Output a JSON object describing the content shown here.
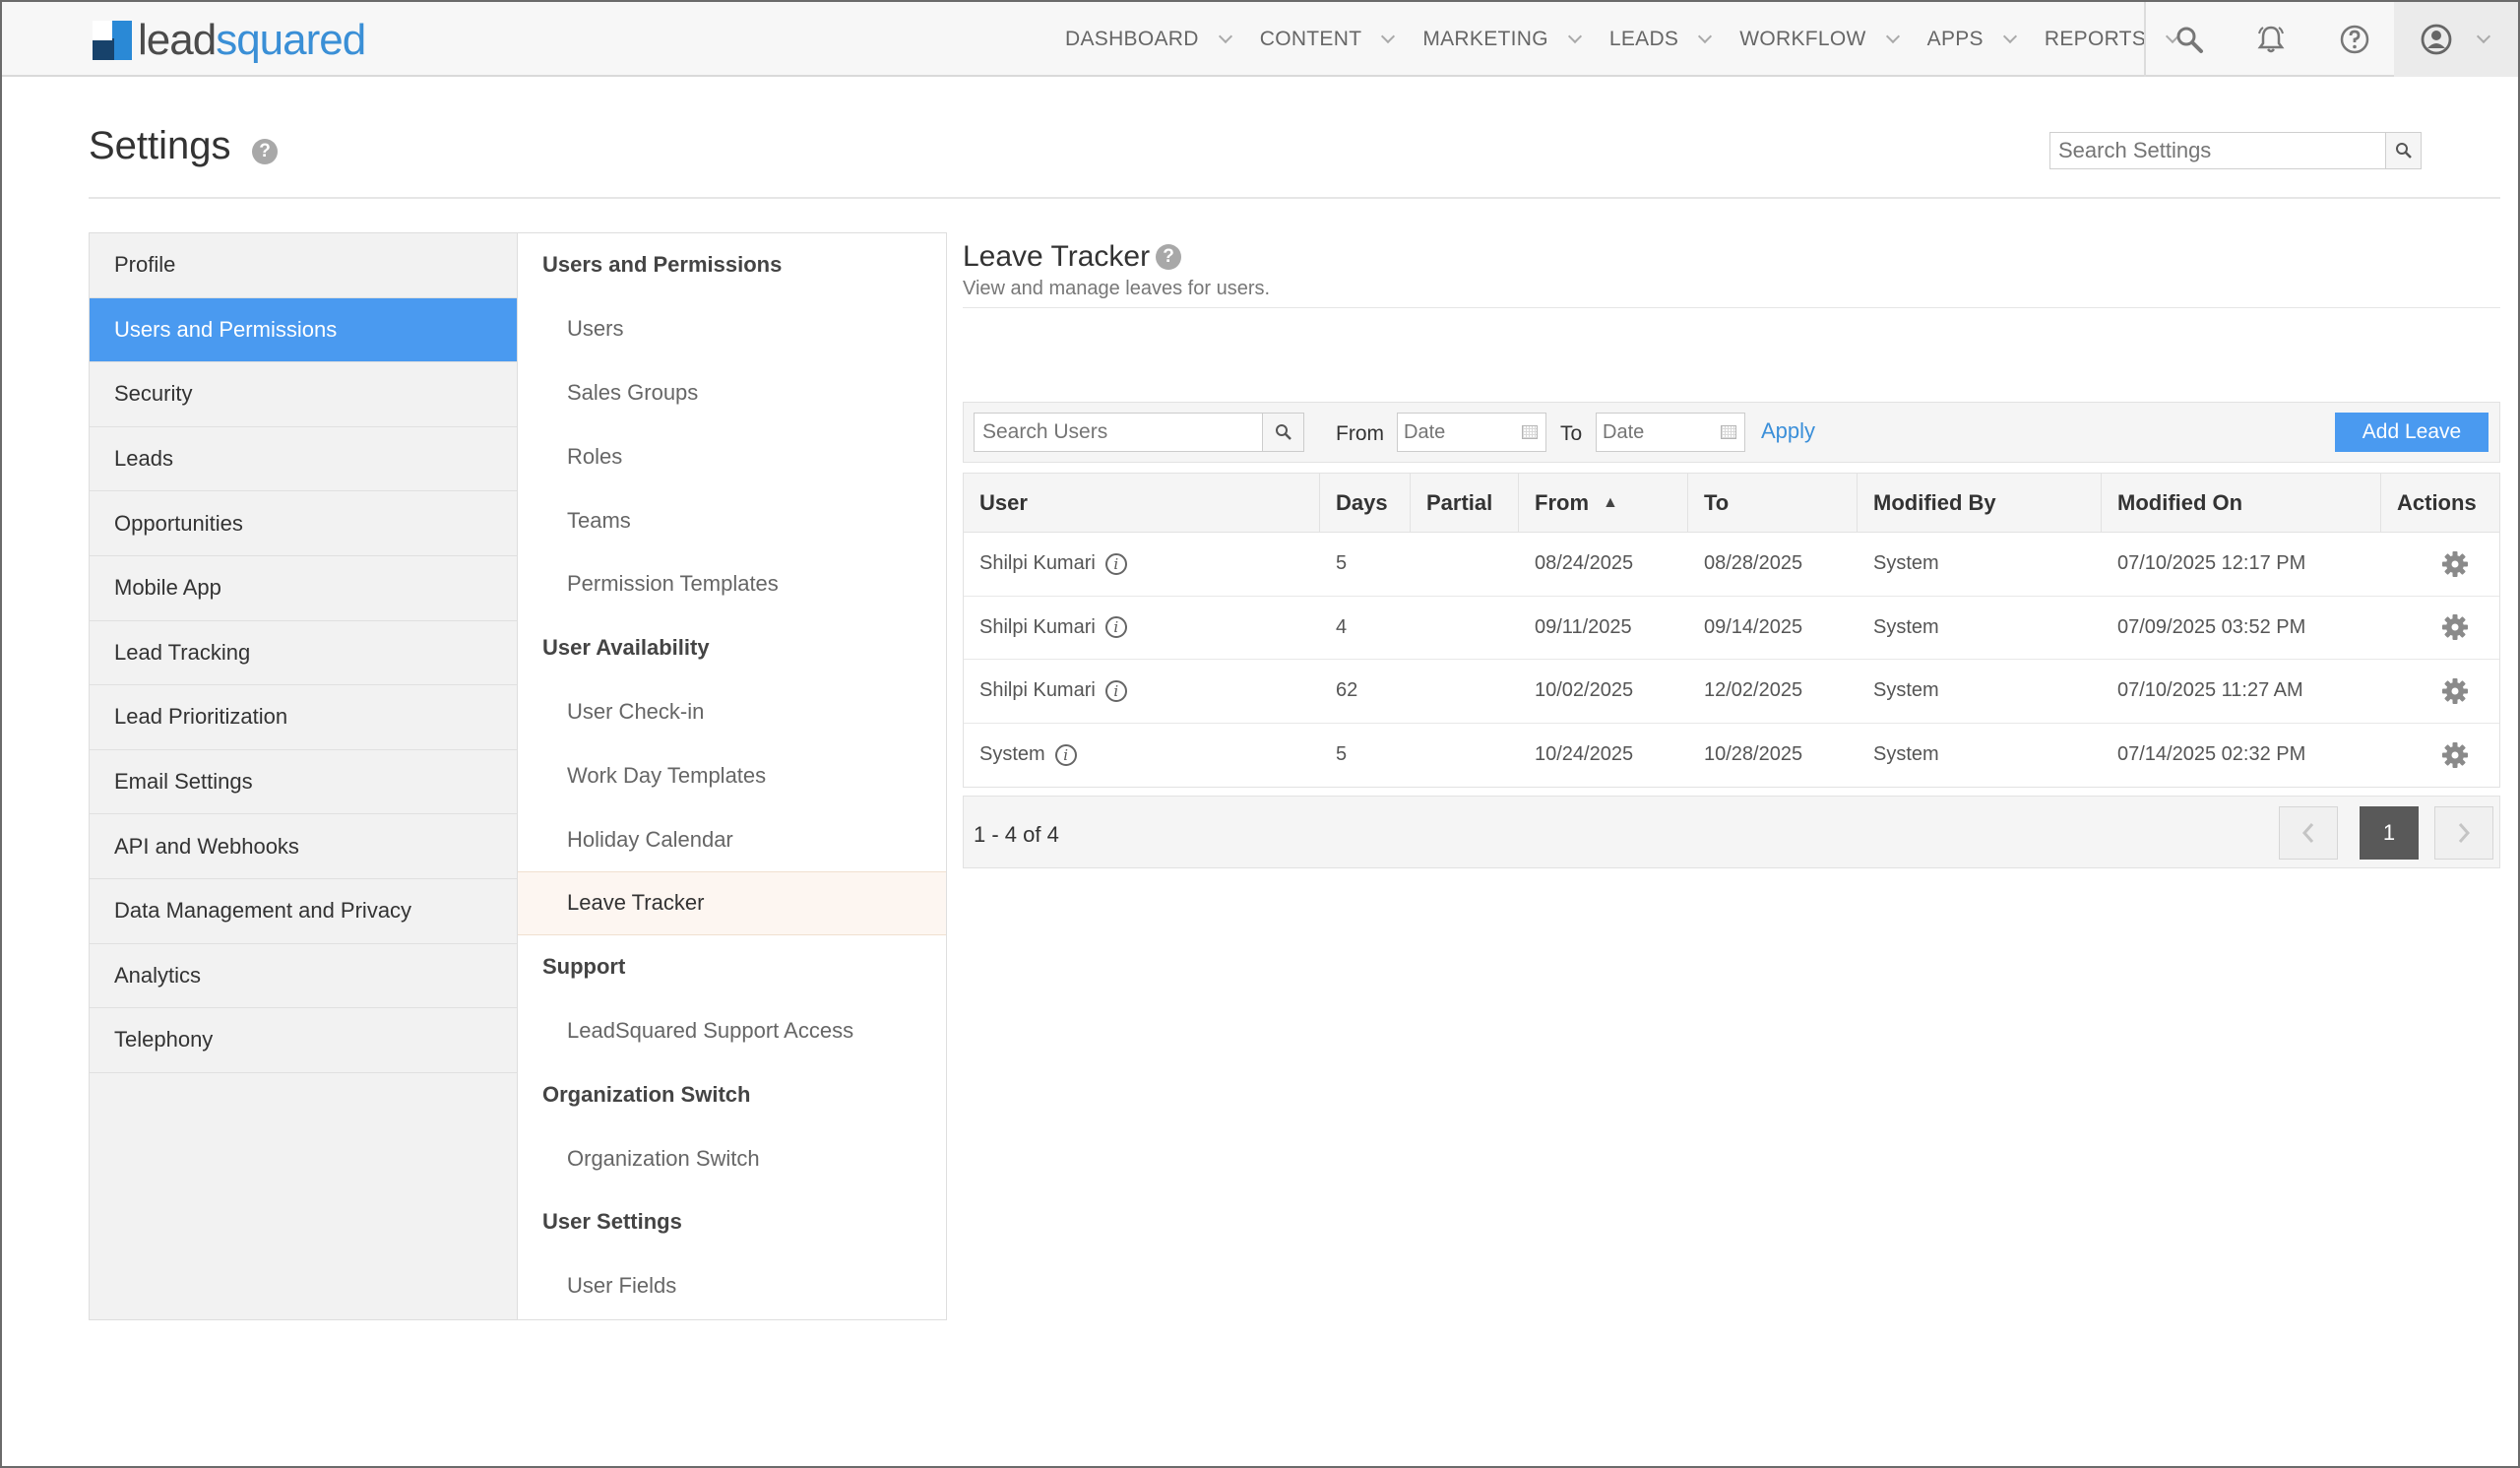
{
  "header": {
    "logo_part1": "lead",
    "logo_part2": "squared",
    "nav": [
      {
        "label": "DASHBOARD"
      },
      {
        "label": "CONTENT"
      },
      {
        "label": "MARKETING"
      },
      {
        "label": "LEADS"
      },
      {
        "label": "WORKFLOW"
      },
      {
        "label": "APPS"
      },
      {
        "label": "REPORTS"
      }
    ]
  },
  "page": {
    "title": "Settings",
    "help_glyph": "?",
    "search_placeholder": "Search Settings"
  },
  "left_menu": [
    {
      "label": "Profile",
      "active": false
    },
    {
      "label": "Users and Permissions",
      "active": true
    },
    {
      "label": "Security",
      "active": false
    },
    {
      "label": "Leads",
      "active": false
    },
    {
      "label": "Opportunities",
      "active": false
    },
    {
      "label": "Mobile App",
      "active": false
    },
    {
      "label": "Lead Tracking",
      "active": false
    },
    {
      "label": "Lead Prioritization",
      "active": false
    },
    {
      "label": "Email Settings",
      "active": false
    },
    {
      "label": "API and Webhooks",
      "active": false
    },
    {
      "label": "Data Management and Privacy",
      "active": false
    },
    {
      "label": "Analytics",
      "active": false
    },
    {
      "label": "Telephony",
      "active": false
    }
  ],
  "sub_menu": [
    {
      "type": "head",
      "label": "Users and Permissions"
    },
    {
      "type": "item",
      "label": "Users"
    },
    {
      "type": "item",
      "label": "Sales Groups"
    },
    {
      "type": "item",
      "label": "Roles"
    },
    {
      "type": "item",
      "label": "Teams"
    },
    {
      "type": "item",
      "label": "Permission Templates"
    },
    {
      "type": "head",
      "label": "User Availability"
    },
    {
      "type": "item",
      "label": "User Check-in"
    },
    {
      "type": "item",
      "label": "Work Day Templates"
    },
    {
      "type": "item",
      "label": "Holiday Calendar"
    },
    {
      "type": "item",
      "label": "Leave Tracker",
      "active": true
    },
    {
      "type": "head",
      "label": "Support"
    },
    {
      "type": "item",
      "label": "LeadSquared Support Access"
    },
    {
      "type": "head",
      "label": "Organization Switch"
    },
    {
      "type": "item",
      "label": "Organization Switch"
    },
    {
      "type": "head",
      "label": "User Settings"
    },
    {
      "type": "item",
      "label": "User Fields"
    }
  ],
  "content": {
    "title": "Leave Tracker",
    "subtitle": "View and manage leaves for users.",
    "filters": {
      "search_placeholder": "Search Users",
      "from_label": "From",
      "to_label": "To",
      "date_placeholder": "Date",
      "apply_label": "Apply",
      "add_label": "Add Leave"
    },
    "table": {
      "columns": [
        "User",
        "Days",
        "Partial",
        "From",
        "To",
        "Modified By",
        "Modified On",
        "Actions"
      ],
      "rows": [
        {
          "user": "Shilpi Kumari",
          "days": "5",
          "partial": "",
          "from": "08/24/2025",
          "to": "08/28/2025",
          "modified_by": "System",
          "modified_on": "07/10/2025 12:17 PM"
        },
        {
          "user": "Shilpi Kumari",
          "days": "4",
          "partial": "",
          "from": "09/11/2025",
          "to": "09/14/2025",
          "modified_by": "System",
          "modified_on": "07/09/2025 03:52 PM"
        },
        {
          "user": "Shilpi Kumari",
          "days": "62",
          "partial": "",
          "from": "10/02/2025",
          "to": "12/02/2025",
          "modified_by": "System",
          "modified_on": "07/10/2025 11:27 AM"
        },
        {
          "user": "System",
          "days": "5",
          "partial": "",
          "from": "10/24/2025",
          "to": "10/28/2025",
          "modified_by": "System",
          "modified_on": "07/14/2025 02:32 PM"
        }
      ]
    },
    "pagination": {
      "summary": "1 - 4 of 4",
      "current_page": "1"
    }
  },
  "colors": {
    "accent": "#4a9af0",
    "link": "#3b8fd9",
    "active_sub_bg": "#fdf6f1"
  }
}
